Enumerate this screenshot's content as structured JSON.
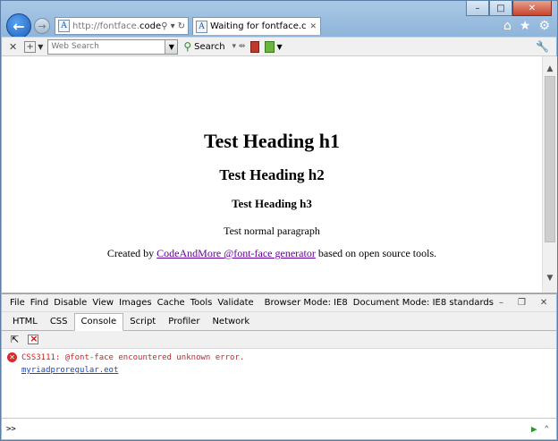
{
  "window": {
    "caption_buttons": {
      "minimize": "–",
      "maximize": "□",
      "close": "✕"
    }
  },
  "nav": {
    "back_glyph": "←",
    "forward_glyph": "→",
    "address_prefix": "http://fontface.",
    "address_bold": "code...",
    "address_icons": [
      "⚲",
      "▾",
      "↻"
    ],
    "tab_title": "Waiting for fontface.codea...",
    "tab_close": "✕",
    "right_icons": [
      "⌂",
      "★",
      "⚙"
    ]
  },
  "toolbar": {
    "close_glyph": "✕",
    "search_placeholder": "Web Search",
    "search_label": "Search"
  },
  "page": {
    "h1": "Test Heading h1",
    "h2": "Test Heading h2",
    "h3": "Test Heading h3",
    "paragraph": "Test normal paragraph",
    "credit_prefix": "Created by ",
    "credit_link": "CodeAndMore @font-face generator",
    "credit_suffix": " based on open source tools."
  },
  "devtools": {
    "menu": [
      {
        "label": "File"
      },
      {
        "label": "Find"
      },
      {
        "label": "Disable"
      },
      {
        "label": "View"
      },
      {
        "label": "Images"
      },
      {
        "label": "Cache"
      },
      {
        "label": "Tools"
      },
      {
        "label": "Validate"
      }
    ],
    "browser_mode": "Browser Mode: IE8",
    "document_mode": "Document Mode: IE8 standards",
    "tabs": [
      "HTML",
      "CSS",
      "Console",
      "Script",
      "Profiler",
      "Network"
    ],
    "active_tab": "Console",
    "console": {
      "error_message": "CSS3111: @font-face encountered unknown error.",
      "error_file": "myriadproregular.eot"
    },
    "prompt": ">>"
  }
}
